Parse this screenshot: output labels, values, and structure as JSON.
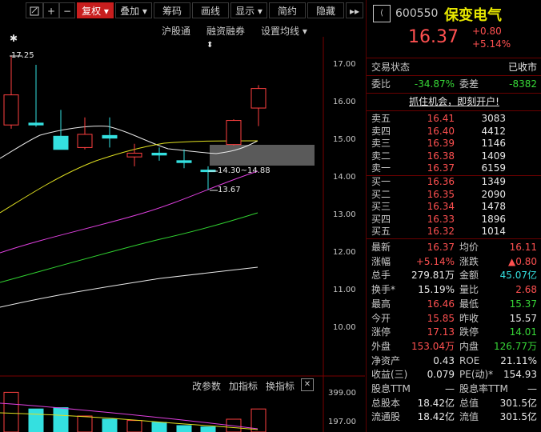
{
  "toolbar": {
    "restore_icon": "restore-icon",
    "plus": "+",
    "minus": "−",
    "fuquan": "复权",
    "diejia": "叠加",
    "chouma": "筹码",
    "huaxian": "画线",
    "xianshi": "显示",
    "jianyue": "简约",
    "yincang": "隐藏"
  },
  "chart": {
    "links": {
      "hugutong": "沪股通",
      "rongzi": "融资融券",
      "shezhi": "设置均线"
    },
    "high_label": "17.25",
    "low_label": "13.67",
    "range_label": "14.30~14.88",
    "y_ticks": [
      "17.00",
      "16.00",
      "15.00",
      "14.00",
      "13.00",
      "12.00",
      "11.00",
      "10.00"
    ],
    "sub": {
      "gaicanshu": "改参数",
      "jiazhibiao": "加指标",
      "huanzhibiao": "换指标",
      "close": "✕",
      "ticks": [
        "399.00",
        "197.00"
      ]
    }
  },
  "chart_data": {
    "type": "candlestick",
    "candles": [
      {
        "o": 15.4,
        "h": 17.25,
        "l": 15.3,
        "c": 16.2,
        "up": true
      },
      {
        "o": 15.45,
        "h": 17.0,
        "l": 15.35,
        "c": 15.4,
        "up": false
      },
      {
        "o": 15.1,
        "h": 15.8,
        "l": 14.85,
        "c": 14.75,
        "up": false
      },
      {
        "o": 14.8,
        "h": 15.6,
        "l": 14.75,
        "c": 15.15,
        "up": true
      },
      {
        "o": 15.12,
        "h": 15.6,
        "l": 14.8,
        "c": 15.05,
        "up": false
      },
      {
        "o": 14.65,
        "h": 14.9,
        "l": 14.3,
        "c": 14.55,
        "up": true
      },
      {
        "o": 14.65,
        "h": 14.8,
        "l": 14.45,
        "c": 14.6,
        "up": false
      },
      {
        "o": 14.45,
        "h": 14.75,
        "l": 14.25,
        "c": 14.4,
        "up": false
      },
      {
        "o": 14.2,
        "h": 14.3,
        "l": 13.67,
        "c": 14.18,
        "up": false
      },
      {
        "o": 14.88,
        "h": 15.55,
        "l": 14.85,
        "c": 15.52,
        "up": true
      },
      {
        "o": 15.85,
        "h": 16.46,
        "l": 15.37,
        "c": 16.37,
        "up": true
      }
    ]
  },
  "panel": {
    "code": "600550",
    "name": "保变电气",
    "price": "16.37",
    "change": "+0.80",
    "change_pct": "+5.14%",
    "status_label": "交易状态",
    "status_value": "已收市",
    "weibi_label": "委比",
    "weibi_value": "-34.87%",
    "weicha_label": "委差",
    "weicha_value": "-8382",
    "promo": "抓住机会，即刻开户!",
    "asks": [
      {
        "label": "卖五",
        "price": "16.41",
        "vol": "3083"
      },
      {
        "label": "卖四",
        "price": "16.40",
        "vol": "4412"
      },
      {
        "label": "卖三",
        "price": "16.39",
        "vol": "1146"
      },
      {
        "label": "卖二",
        "price": "16.38",
        "vol": "1409"
      },
      {
        "label": "卖一",
        "price": "16.37",
        "vol": "6159"
      }
    ],
    "bids": [
      {
        "label": "买一",
        "price": "16.36",
        "vol": "1349"
      },
      {
        "label": "买二",
        "price": "16.35",
        "vol": "2090"
      },
      {
        "label": "买三",
        "price": "16.34",
        "vol": "1478"
      },
      {
        "label": "买四",
        "price": "16.33",
        "vol": "1896"
      },
      {
        "label": "买五",
        "price": "16.32",
        "vol": "1014"
      }
    ],
    "stats": [
      {
        "l1": "最新",
        "v1": "16.37",
        "c1": "red",
        "l2": "均价",
        "v2": "16.11",
        "c2": "red"
      },
      {
        "l1": "涨幅",
        "v1": "+5.14%",
        "c1": "red",
        "l2": "涨跌",
        "v2": "▲0.80",
        "c2": "red"
      },
      {
        "l1": "总手",
        "v1": "279.81万",
        "c1": "white",
        "l2": "金额",
        "v2": "45.07亿",
        "c2": "cyan"
      },
      {
        "l1": "换手*",
        "v1": "15.19%",
        "c1": "white",
        "l2": "量比",
        "v2": "2.68",
        "c2": "red"
      },
      {
        "l1": "最高",
        "v1": "16.46",
        "c1": "red",
        "l2": "最低",
        "v2": "15.37",
        "c2": "green"
      },
      {
        "l1": "今开",
        "v1": "15.85",
        "c1": "red",
        "l2": "昨收",
        "v2": "15.57",
        "c2": "white"
      },
      {
        "l1": "涨停",
        "v1": "17.13",
        "c1": "red",
        "l2": "跌停",
        "v2": "14.01",
        "c2": "green"
      },
      {
        "l1": "外盘",
        "v1": "153.04万",
        "c1": "red",
        "l2": "内盘",
        "v2": "126.77万",
        "c2": "green"
      },
      {
        "l1": "净资产",
        "v1": "0.43",
        "c1": "white",
        "l2": "ROE",
        "v2": "21.11%",
        "c2": "white"
      },
      {
        "l1": "收益(三)",
        "v1": "0.079",
        "c1": "white",
        "l2": "PE(动)*",
        "v2": "154.93",
        "c2": "white"
      },
      {
        "l1": "股息TTM",
        "v1": "—",
        "c1": "white",
        "l2": "股息率TTM",
        "v2": "—",
        "c2": "white"
      },
      {
        "l1": "总股本",
        "v1": "18.42亿",
        "c1": "white",
        "l2": "总值",
        "v2": "301.5亿",
        "c2": "white"
      },
      {
        "l1": "流通股",
        "v1": "18.42亿",
        "c1": "white",
        "l2": "流值",
        "v2": "301.5亿",
        "c2": "white"
      }
    ]
  }
}
